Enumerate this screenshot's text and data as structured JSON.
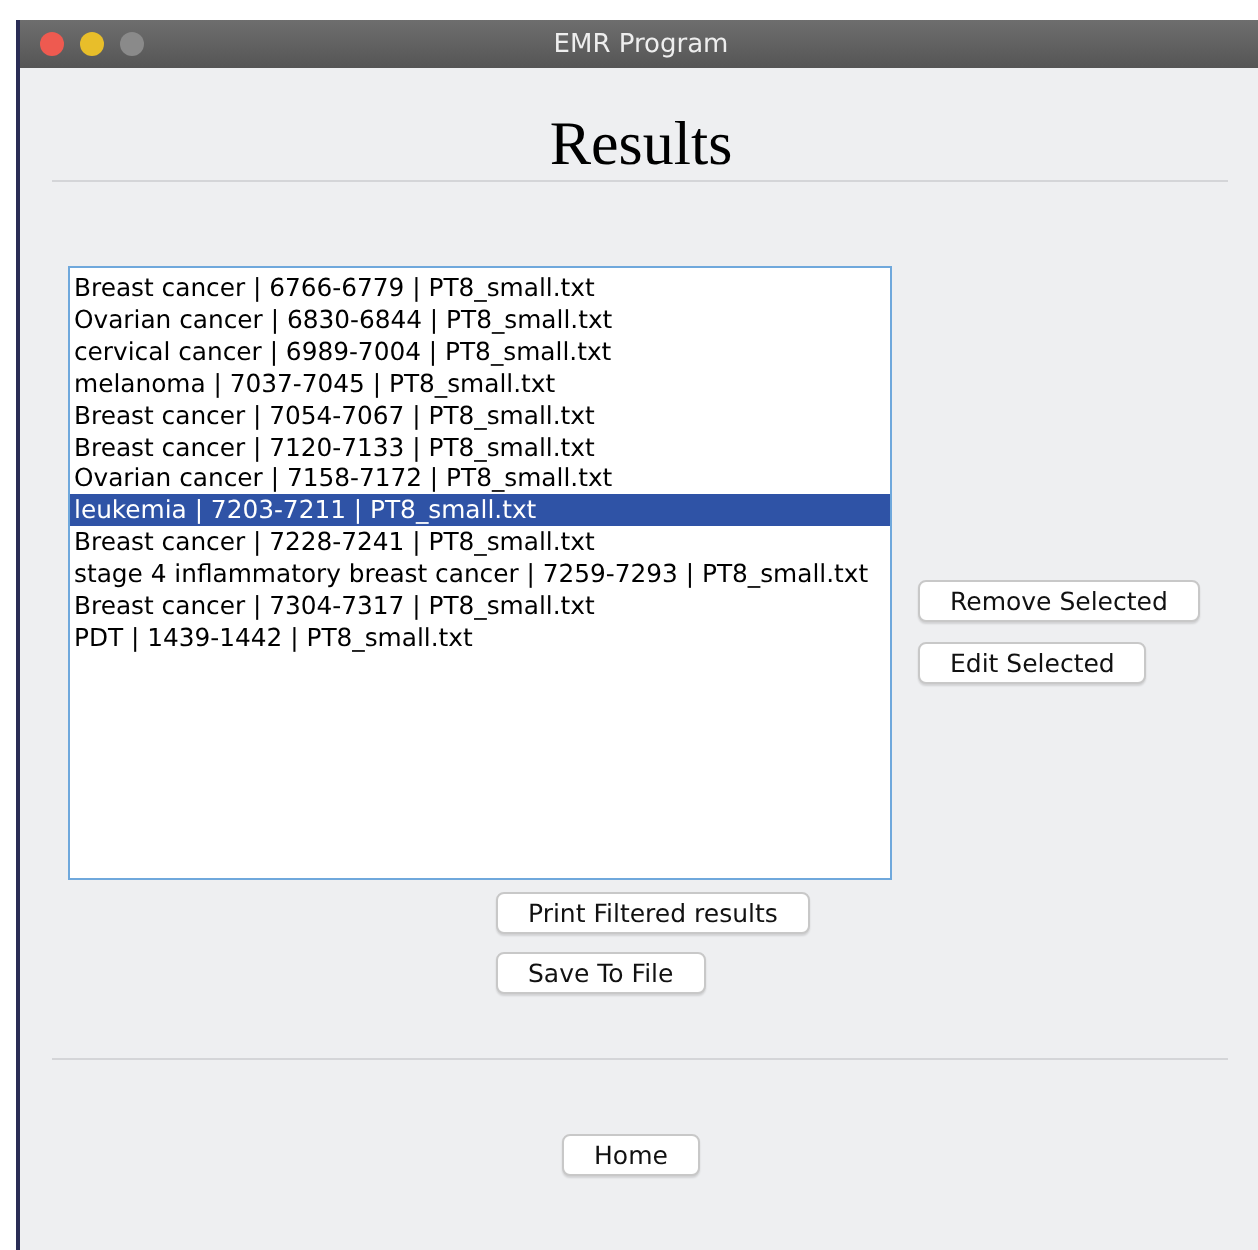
{
  "window": {
    "title": "EMR Program"
  },
  "heading": "Results",
  "results": [
    {
      "label": "Breast cancer | 6766-6779 | PT8_small.txt",
      "selected": false
    },
    {
      "label": "Ovarian cancer | 6830-6844 | PT8_small.txt",
      "selected": false
    },
    {
      "label": "cervical cancer | 6989-7004 | PT8_small.txt",
      "selected": false
    },
    {
      "label": "melanoma | 7037-7045 | PT8_small.txt",
      "selected": false
    },
    {
      "label": "Breast cancer | 7054-7067 | PT8_small.txt",
      "selected": false
    },
    {
      "label": "Breast cancer | 7120-7133 | PT8_small.txt",
      "selected": false
    },
    {
      "label": "Ovarian cancer | 7158-7172 | PT8_small.txt",
      "selected": false
    },
    {
      "label": "leukemia | 7203-7211 | PT8_small.txt",
      "selected": true
    },
    {
      "label": "Breast cancer | 7228-7241 | PT8_small.txt",
      "selected": false
    },
    {
      "label": "stage 4 inflammatory breast cancer | 7259-7293 | PT8_small.txt",
      "selected": false
    },
    {
      "label": "Breast cancer | 7304-7317 | PT8_small.txt",
      "selected": false
    },
    {
      "label": "PDT | 1439-1442 | PT8_small.txt",
      "selected": false
    }
  ],
  "side_buttons": [
    "Remove Selected",
    "Edit Selected"
  ],
  "bottom_buttons": [
    "Print Filtered results",
    "Save To File"
  ],
  "home_button": "Home"
}
